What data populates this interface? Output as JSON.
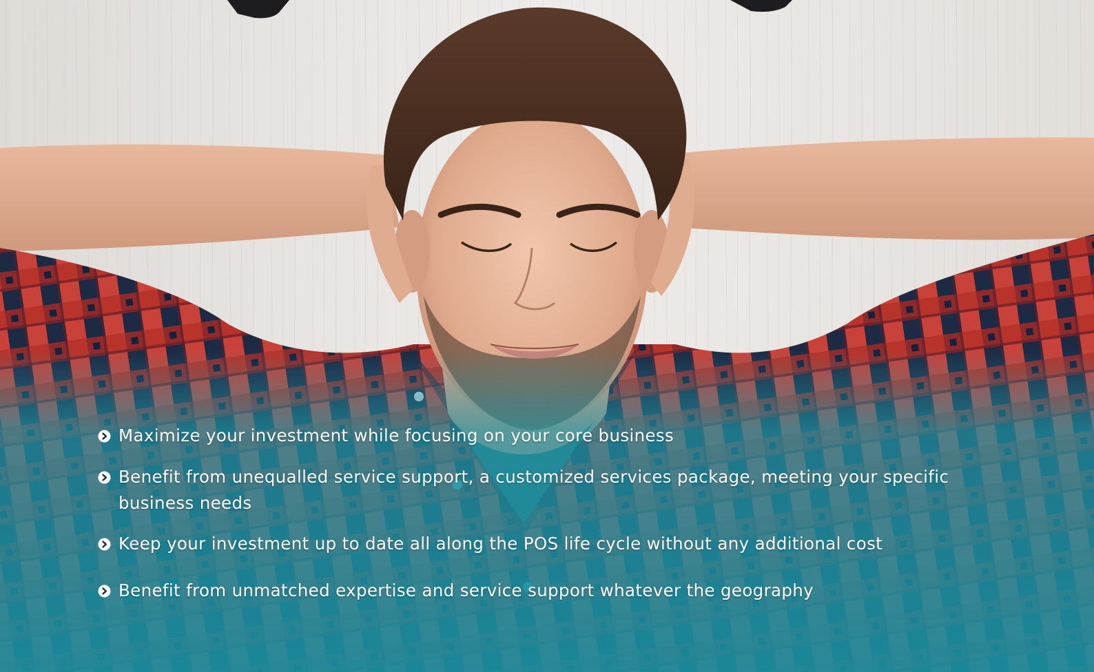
{
  "benefits": [
    {
      "text": "Maximize your investment while focusing on your core business",
      "icon": "chevron-right-circle-icon"
    },
    {
      "text": "Benefit from unequalled service support, a customized services package, meeting your specific business needs",
      "icon": "chevron-right-circle-icon"
    },
    {
      "text": "Keep your investment up to date all along the POS life cycle without any additional cost",
      "icon": "chevron-right-circle-icon"
    },
    {
      "text": "Benefit from unmatched expertise and service support whatever the geography",
      "icon": "chevron-right-circle-icon"
    }
  ],
  "colors": {
    "text": "#ffffff",
    "teal_overlay": "#1f96a6",
    "background_wood": "#e8e6e3",
    "shirt_red": "#c0392b",
    "shirt_navy": "#1d2a44"
  }
}
